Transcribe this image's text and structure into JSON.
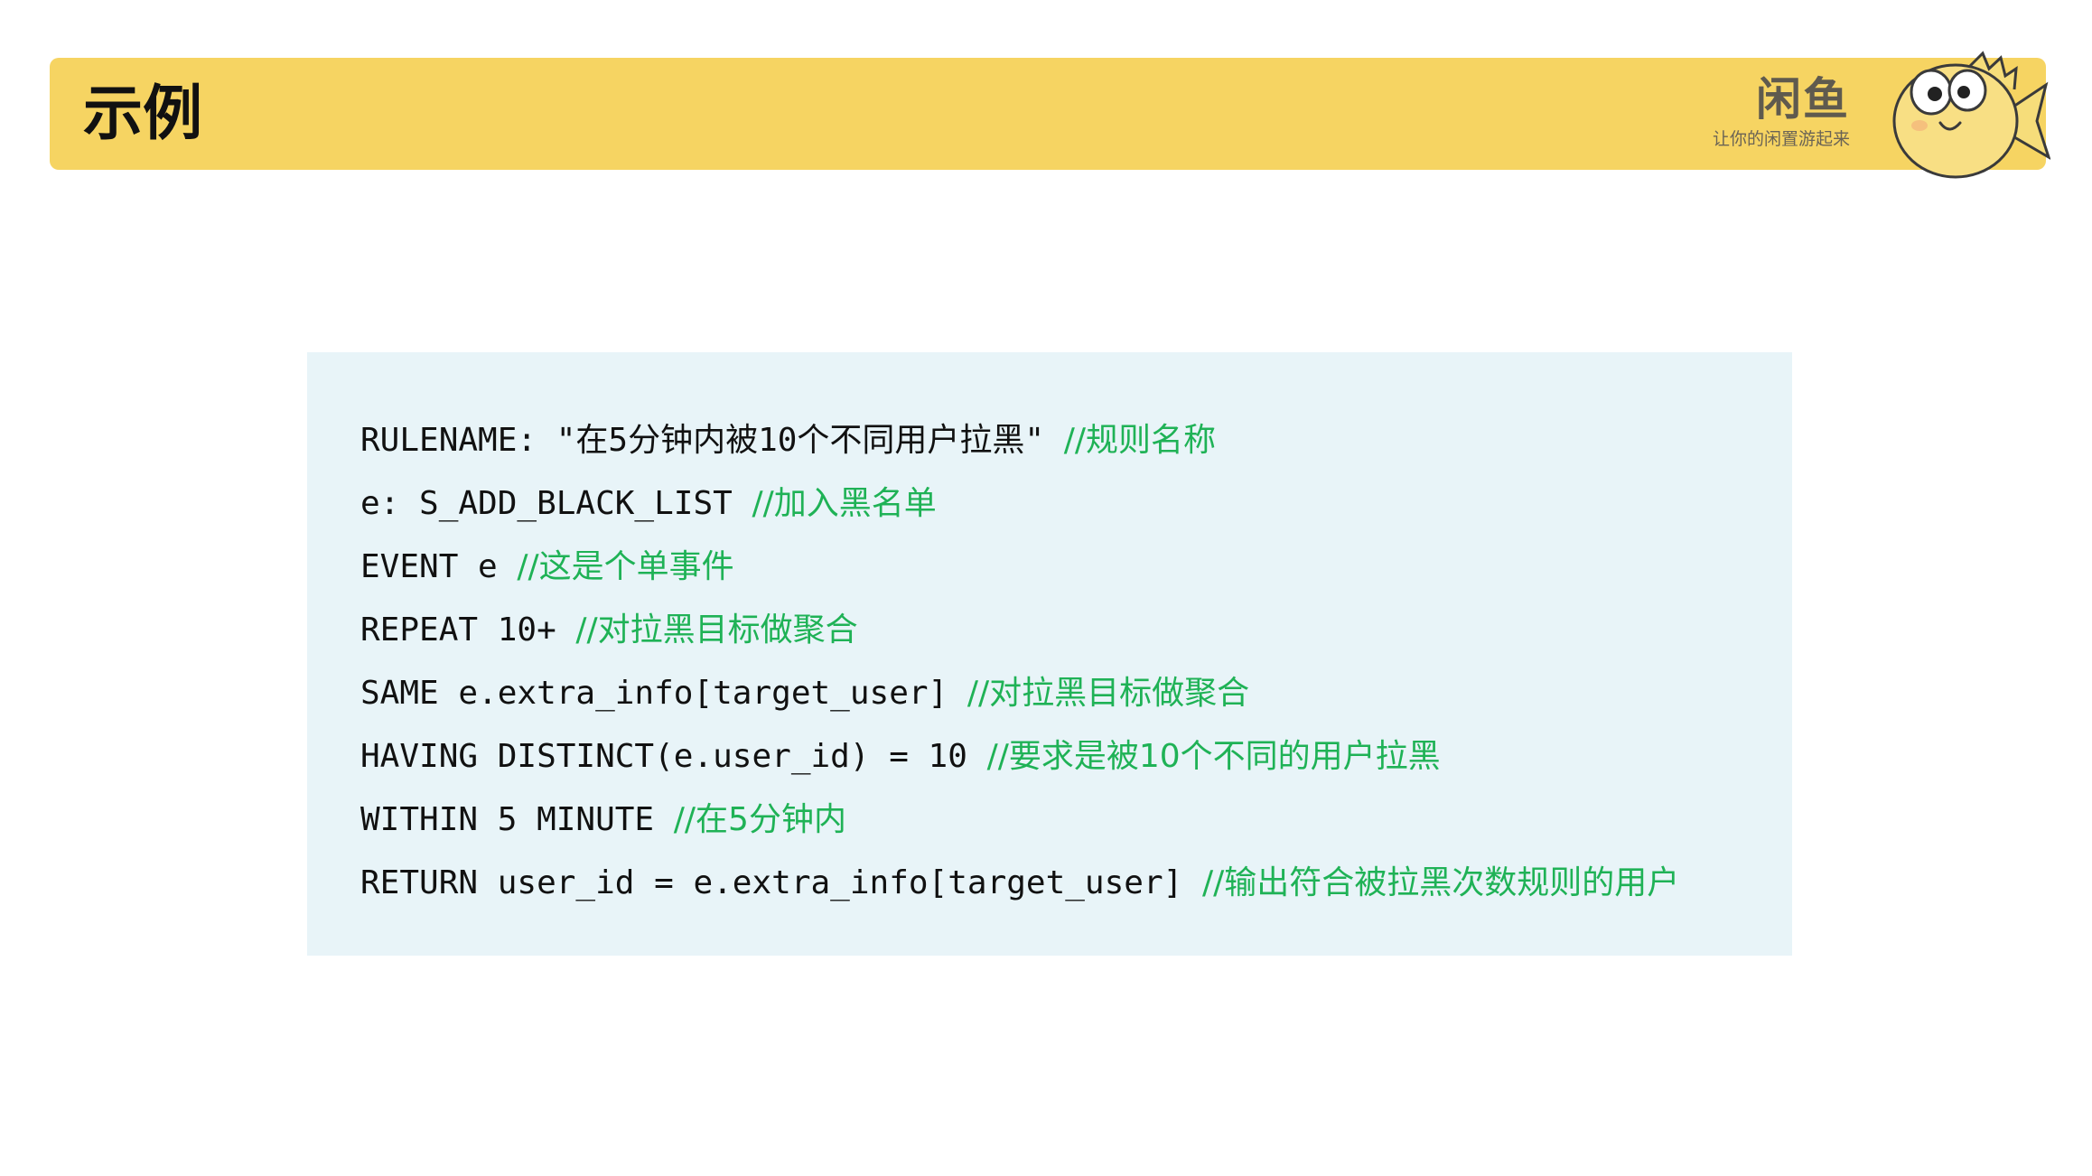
{
  "header": {
    "title": "示例",
    "brand_name": "闲鱼",
    "brand_slogan": "让你的闲置游起来",
    "accent_color": "#f6d462"
  },
  "code_block": {
    "background_color": "#e8f4f8",
    "code_color": "#111111",
    "comment_color": "#1fb256",
    "lines": [
      {
        "code": "RULENAME: \"在5分钟内被10个不同用户拉黑\" ",
        "comment": "//规则名称"
      },
      {
        "code": "e: S_ADD_BLACK_LIST ",
        "comment": "//加入黑名单"
      },
      {
        "code": "EVENT e ",
        "comment": "//这是个单事件"
      },
      {
        "code": "REPEAT 10+ ",
        "comment": "//对拉黑目标做聚合"
      },
      {
        "code": "SAME e.extra_info[target_user] ",
        "comment": "//对拉黑目标做聚合"
      },
      {
        "code": "HAVING DISTINCT(e.user_id) = 10 ",
        "comment": "//要求是被10个不同的用户拉黑"
      },
      {
        "code": "WITHIN 5 MINUTE ",
        "comment": "//在5分钟内"
      },
      {
        "code": "RETURN user_id = e.extra_info[target_user] ",
        "comment": "//输出符合被拉黑次数规则的用户"
      }
    ]
  }
}
